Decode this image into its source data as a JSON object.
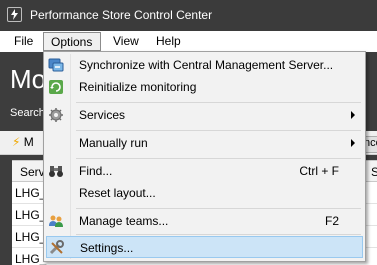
{
  "window": {
    "title": "Performance Store Control Center"
  },
  "menubar": {
    "items": [
      "File",
      "Options",
      "View",
      "Help"
    ]
  },
  "background": {
    "big_title": "Mo",
    "search_label": "Search",
    "toolbar_left": "M",
    "toolbar_right": "nce",
    "grid_header": [
      "Serv",
      "S"
    ],
    "rows": [
      {
        "c1": "LHG_",
        "c2": ""
      },
      {
        "c1": "LHG_",
        "c2": ""
      },
      {
        "c1": "LHG_",
        "c2": ""
      },
      {
        "c1": "LHG_",
        "c2": ""
      }
    ]
  },
  "options_menu": {
    "items": [
      {
        "label": "Synchronize with Central Management Server...",
        "shortcut": "",
        "icon": "sync-icon"
      },
      {
        "label": "Reinitialize monitoring",
        "shortcut": "",
        "icon": "refresh-icon"
      },
      {
        "label": "Services",
        "shortcut": "",
        "icon": "gear-icon"
      },
      {
        "label": "Manually run",
        "shortcut": "",
        "icon": ""
      },
      {
        "label": "Find...",
        "shortcut": "Ctrl + F",
        "icon": "binoculars-icon"
      },
      {
        "label": "Reset layout...",
        "shortcut": "",
        "icon": ""
      },
      {
        "label": "Manage teams...",
        "shortcut": "F2",
        "icon": "team-icon"
      },
      {
        "label": "Settings...",
        "shortcut": "",
        "icon": "settings-icon"
      }
    ]
  },
  "colors": {
    "titlebar": "#3b3b3b",
    "app_background": "#3d3d3d",
    "menu_highlight": "#cce4f7",
    "menu_highlight_border": "#99c9ef",
    "accent_bolt": "#f0a800"
  }
}
